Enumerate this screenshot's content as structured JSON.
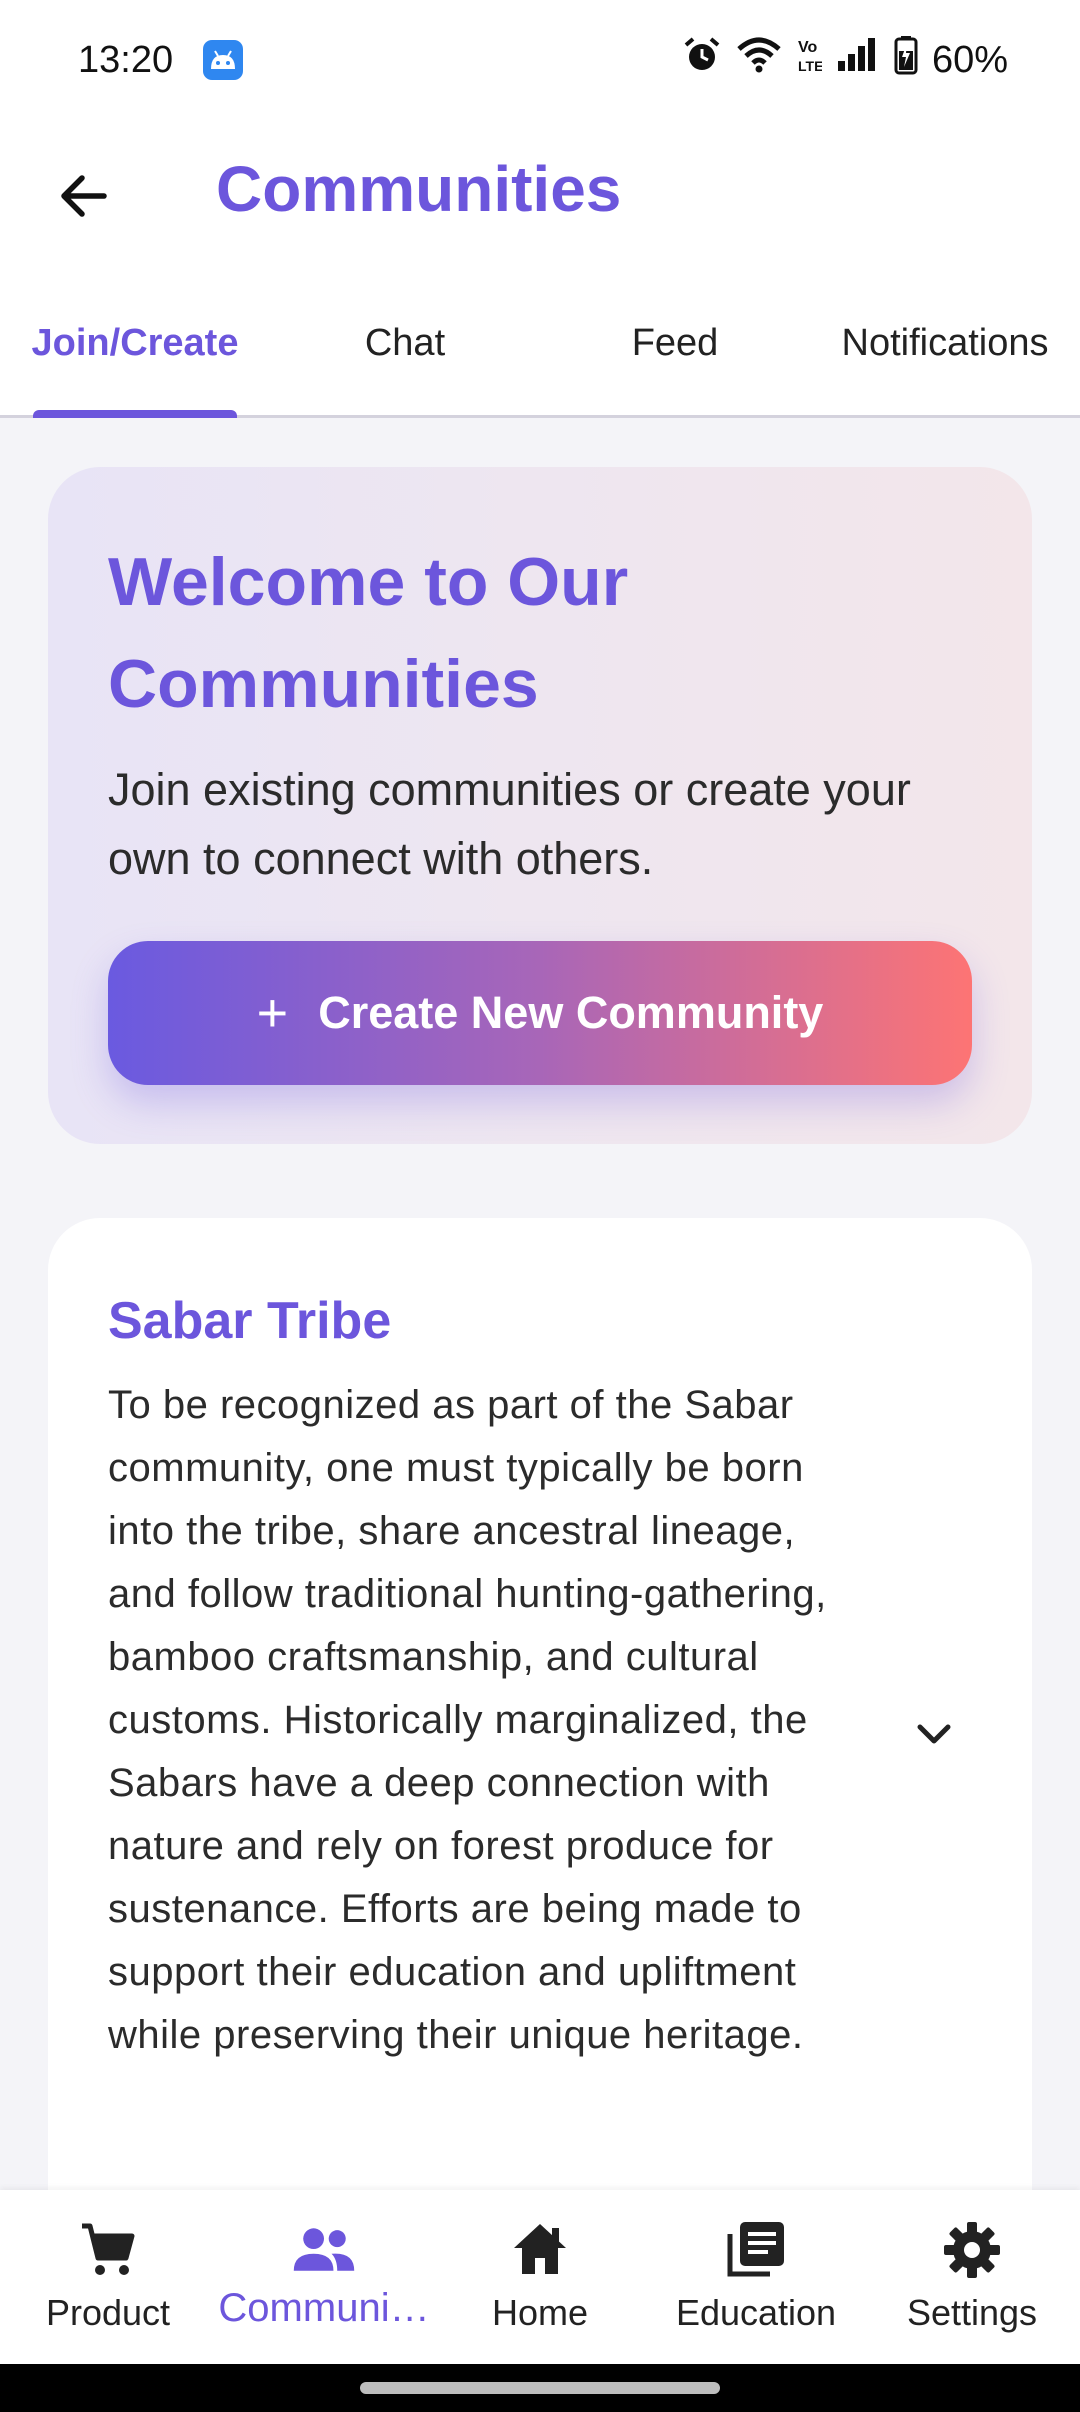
{
  "status_bar": {
    "time": "13:20",
    "battery": "60%",
    "icons": [
      "android-app-icon",
      "alarm-icon",
      "wifi-icon",
      "volte-icon",
      "signal-icon",
      "battery-icon"
    ]
  },
  "app_bar": {
    "title": "Communities",
    "back_icon": "arrow-back-icon"
  },
  "tabs": [
    {
      "label": "Join/Create",
      "active": true
    },
    {
      "label": "Chat",
      "active": false
    },
    {
      "label": "Feed",
      "active": false
    },
    {
      "label": "Notifications",
      "active": false
    }
  ],
  "welcome": {
    "title": "Welcome to Our Communities",
    "subtitle": "Join existing communities or create your own to connect with others.",
    "create_button": "Create New Community"
  },
  "communities": [
    {
      "name": "Sabar Tribe",
      "description": "To be recognized as part of the Sabar community, one must typically be born into the tribe, share ancestral lineage, and follow traditional hunting-gathering, bamboo craftsmanship, and cultural customs. Historically marginalized, the Sabars have a deep connection with nature and rely on forest produce for sustenance. Efforts are being made to support their education and upliftment while preserving their unique heritage."
    }
  ],
  "bottom_nav": [
    {
      "label": "Product",
      "icon": "cart-icon",
      "active": false
    },
    {
      "label": "Communi…",
      "icon": "people-icon",
      "active": true
    },
    {
      "label": "Home",
      "icon": "home-icon",
      "active": false
    },
    {
      "label": "Education",
      "icon": "library-books-icon",
      "active": false
    },
    {
      "label": "Settings",
      "icon": "gear-icon",
      "active": false
    }
  ],
  "colors": {
    "accent": "#6c56dc",
    "gradient_start": "#6a5ae0",
    "gradient_end": "#fd7474",
    "background": "#f4f4f8"
  }
}
